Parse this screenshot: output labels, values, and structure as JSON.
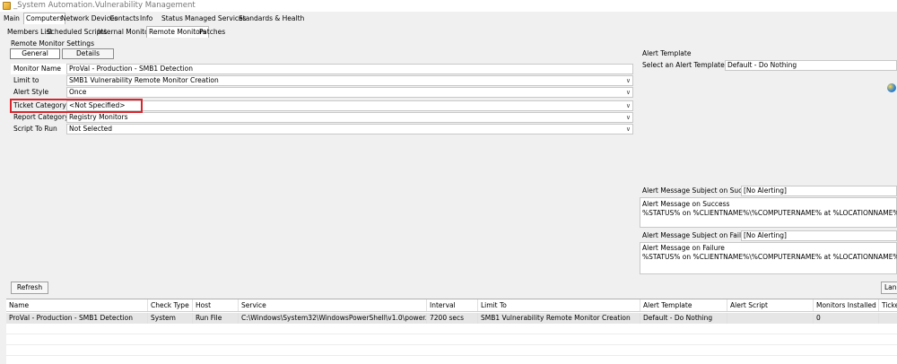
{
  "window": {
    "title": "_System Automation.Vulnerability Management"
  },
  "main_tabs": [
    {
      "label": "Main"
    },
    {
      "label": "Computers"
    },
    {
      "label": "Network Devices"
    },
    {
      "label": "Contacts"
    },
    {
      "label": "Info"
    },
    {
      "label": "Status"
    },
    {
      "label": "Managed Services"
    },
    {
      "label": "Standards & Health"
    }
  ],
  "sub_tabs": [
    {
      "label": "Members List"
    },
    {
      "label": "Scheduled Scripts"
    },
    {
      "label": "Internal Monitors"
    },
    {
      "label": "Remote Monitors"
    },
    {
      "label": "Patches"
    }
  ],
  "settings": {
    "section_title": "Remote Monitor Settings",
    "tab_general": "General",
    "tab_details": "Details",
    "fields": [
      {
        "label": "Monitor Name",
        "value": "ProVal - Production - SMB1 Detection",
        "dropdown": false
      },
      {
        "label": "Limit to",
        "value": "SMB1 Vulnerability Remote Monitor Creation",
        "dropdown": true
      },
      {
        "label": "Alert Style",
        "value": "Once",
        "dropdown": true
      },
      {
        "label": "Ticket Category",
        "value": "<Not Specified>",
        "dropdown": true
      },
      {
        "label": "Report Category",
        "value": "Registry Monitors",
        "dropdown": true
      },
      {
        "label": "Script To Run",
        "value": "Not Selected",
        "dropdown": true
      }
    ]
  },
  "alert": {
    "section_title": "Alert Template",
    "select_label": "Select an Alert Template",
    "select_value": "Default - Do Nothing",
    "success_subject_label": "Alert Message Subject on Success:",
    "success_subject_value": "[No Alerting]",
    "success_message_label": "Alert Message on Success",
    "success_message_value": "%STATUS% on %CLIENTNAME%\\%COMPUTERNAME% at %LOCATIONNAME% for %FIELDNAM",
    "failure_subject_label": "Alert Message Subject on Failure:",
    "failure_subject_value": "[No Alerting]",
    "failure_message_label": "Alert Message on Failure",
    "failure_message_value": "%STATUS% on %CLIENTNAME%\\%COMPUTERNAME% at %LOCATIONNAME% for %FIELDNAM"
  },
  "toolbar": {
    "refresh_label": "Refresh",
    "lang_label": "Lang"
  },
  "grid": {
    "columns": [
      "Name",
      "Check Type",
      "Host",
      "Service",
      "Interval",
      "Limit To",
      "Alert Template",
      "Alert Script",
      "Monitors Installed",
      "Ticke"
    ],
    "rows": [
      [
        "ProVal - Production - SMB1 Detection",
        "System",
        "Run File",
        "C:\\Windows\\System32\\WindowsPowerShell\\v1.0\\power...",
        "7200 secs",
        "SMB1 Vulnerability Remote Monitor Creation",
        "Default - Do Nothing",
        "",
        "0",
        ""
      ]
    ]
  },
  "colors": {
    "highlight": "#d9242c",
    "background": "#f0f0f0",
    "selected_row": "#e6e6e6"
  },
  "icons": {
    "app": "app-icon",
    "dropdown": "chevron-down-icon",
    "windows": "windows-logo-icon"
  }
}
